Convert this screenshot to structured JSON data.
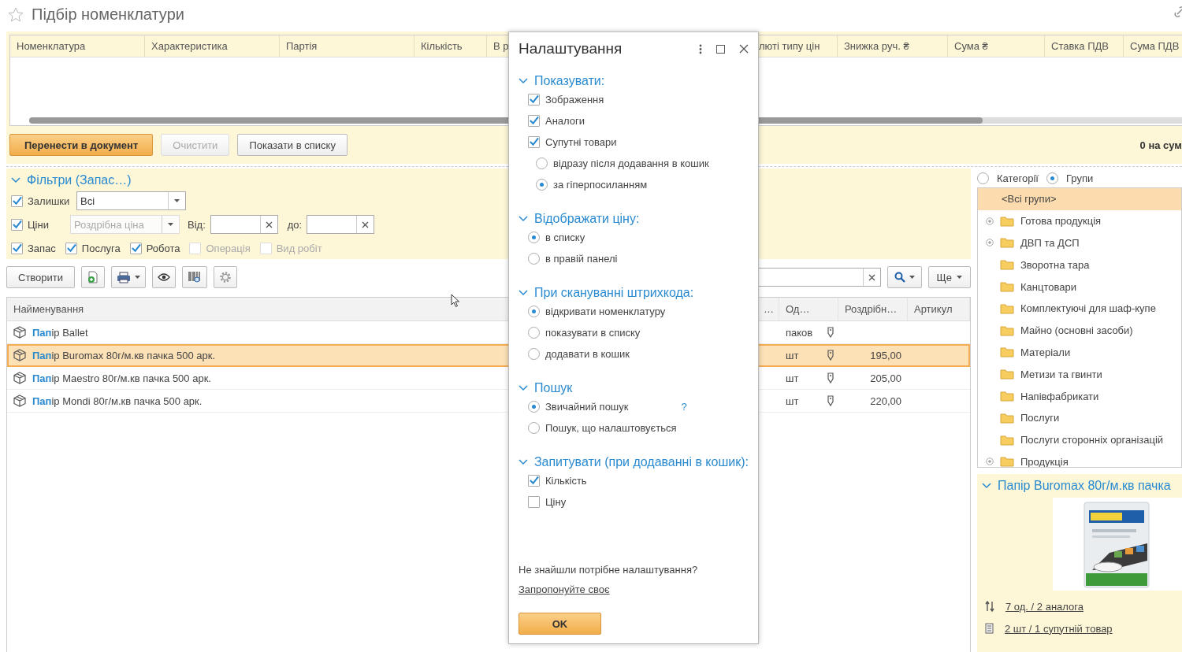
{
  "title": "Підбір номенклатури",
  "cart_table": {
    "columns": [
      "Номенклатура",
      "Характеристика",
      "Партія",
      "Кількість",
      "В р",
      "люті типу цін",
      "Знижка руч. ₴",
      "Сума ₴",
      "Ставка ПДВ",
      "Сума ПДВ"
    ]
  },
  "cart_actions": [
    {
      "label": "Перенести в документ",
      "kind": "primary"
    },
    {
      "label": "Очистити",
      "kind": "disabled"
    },
    {
      "label": "Показати в списку",
      "kind": "normal"
    }
  ],
  "cart_total": "0 на сум",
  "filters": {
    "title": "Фільтри (Запас…)",
    "expanded": true,
    "stock": {
      "label": "Залишки",
      "checked": true,
      "value": "Всі"
    },
    "prices": {
      "label": "Ціни",
      "checked": true,
      "value": "Роздрібна ціна",
      "type_disabled": true,
      "from_label": "Від:",
      "to_label": "до:"
    },
    "types": [
      {
        "label": "Запас",
        "checked": true,
        "disabled": false
      },
      {
        "label": "Послуга",
        "checked": true,
        "disabled": false
      },
      {
        "label": "Робота",
        "checked": true,
        "disabled": false
      },
      {
        "label": "Операція",
        "checked": false,
        "disabled": true
      },
      {
        "label": "Вид робіт",
        "checked": false,
        "disabled": true
      }
    ]
  },
  "toolbar": {
    "create": "Створити",
    "more": "Ще"
  },
  "list": {
    "columns": [
      "Найменування",
      "…",
      "Од…",
      "Роздрібн…",
      "Артикул"
    ],
    "rows": [
      {
        "name": "**Пап**ір Ballet",
        "unit": "паков",
        "selected": false
      },
      {
        "name": "**Пап**ір Buromax 80г/м.кв пачка 500 арк.",
        "unit": "шт",
        "price": "195,00",
        "selected": true
      },
      {
        "name": "**Пап**ір Maestro 80г/м.кв пачка 500 арк.",
        "unit": "шт",
        "price": "205,00",
        "selected": false
      },
      {
        "name": "**Пап**ір Mondi 80г/м.кв пачка 500 арк.",
        "unit": "шт",
        "price": "220,00",
        "selected": false
      }
    ]
  },
  "groups": {
    "modes": [
      {
        "label": "Категорії",
        "selected": false
      },
      {
        "label": "Групи",
        "selected": true
      }
    ],
    "items": [
      {
        "label": "<Всі групи>",
        "selected": true,
        "expandable": false
      },
      {
        "label": "Готова продукція",
        "selected": false,
        "expandable": true
      },
      {
        "label": "ДВП та ДСП",
        "selected": false,
        "expandable": true
      },
      {
        "label": "Зворотна тара",
        "selected": false,
        "expandable": false
      },
      {
        "label": "Канцтовари",
        "selected": false,
        "expandable": false
      },
      {
        "label": "Комплектуючі для шаф-купе",
        "selected": false,
        "expandable": false
      },
      {
        "label": "Майно (основні засоби)",
        "selected": false,
        "expandable": false
      },
      {
        "label": "Матеріали",
        "selected": false,
        "expandable": false
      },
      {
        "label": "Метизи та гвинти",
        "selected": false,
        "expandable": false
      },
      {
        "label": "Напівфабрикати",
        "selected": false,
        "expandable": false
      },
      {
        "label": "Послуги",
        "selected": false,
        "expandable": false
      },
      {
        "label": "Послуги сторонніх організацій",
        "selected": false,
        "expandable": false
      },
      {
        "label": "Продукція",
        "selected": false,
        "expandable": true
      }
    ]
  },
  "details": {
    "title": "Папір Buromax 80г/м.кв пачка",
    "expanded": true,
    "links": [
      {
        "text": "7 од. / 2 аналога",
        "kind": "analogs"
      },
      {
        "text": "2 шт / 1 супутній товар",
        "kind": "related"
      }
    ]
  },
  "dialog": {
    "title": "Налаштування",
    "sections": [
      {
        "title": "Показувати:",
        "expanded": true,
        "options": [
          {
            "kind": "checkbox",
            "label": "Зображення",
            "checked": true
          },
          {
            "kind": "checkbox",
            "label": "Аналоги",
            "checked": true
          },
          {
            "kind": "checkbox",
            "label": "Супутні товари",
            "checked": true,
            "children": [
              {
                "kind": "radio",
                "label": "відразу після додавання в кошик",
                "selected": false
              },
              {
                "kind": "radio",
                "label": "за гіперпосиланням",
                "selected": true
              }
            ]
          }
        ]
      },
      {
        "title": "Відображати ціну:",
        "expanded": true,
        "options": [
          {
            "kind": "radio",
            "label": "в списку",
            "selected": true
          },
          {
            "kind": "radio",
            "label": "в правій панелі",
            "selected": false
          }
        ]
      },
      {
        "title": "При скануванні штрихкода:",
        "expanded": true,
        "options": [
          {
            "kind": "radio",
            "label": "відкривати номенклатуру",
            "selected": true
          },
          {
            "kind": "radio",
            "label": "показувати в списку",
            "selected": false
          },
          {
            "kind": "radio",
            "label": "додавати в кошик",
            "selected": false
          }
        ]
      },
      {
        "title": "Пошук",
        "expanded": true,
        "options": [
          {
            "kind": "radio",
            "label": "Звичайний пошук",
            "selected": true,
            "help": "?"
          },
          {
            "kind": "radio",
            "label": "Пошук, що налаштовується",
            "selected": false
          }
        ]
      },
      {
        "title": "Запитувати (при додаванні в кошик):",
        "expanded": true,
        "options": [
          {
            "kind": "checkbox",
            "label": "Кількість",
            "checked": true
          },
          {
            "kind": "checkbox",
            "label": "Ціну",
            "checked": false
          }
        ]
      }
    ],
    "question": "Не знайшли потрібне налаштування?",
    "link": "Запропонуйте своє",
    "ok": "OK"
  }
}
